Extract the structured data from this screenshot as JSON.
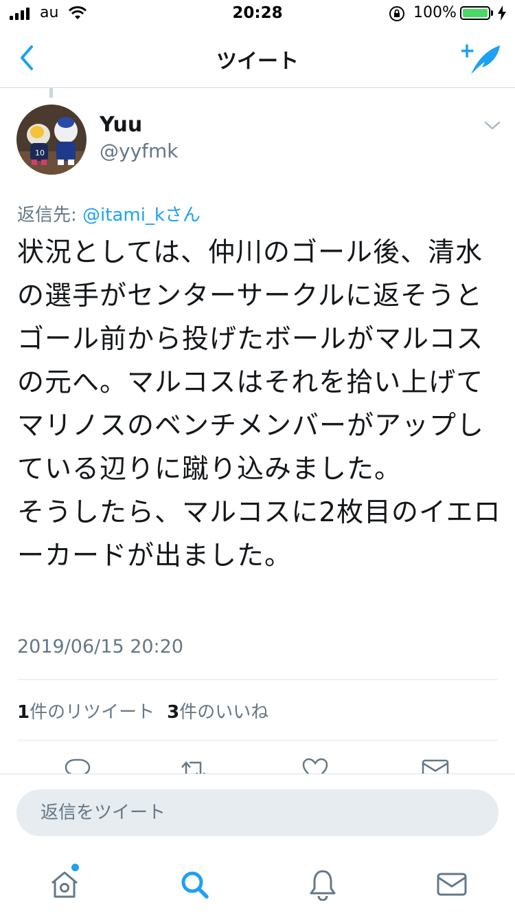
{
  "status_bar": {
    "carrier": "au",
    "time": "20:28",
    "battery_percent": "100%",
    "battery_level": 1.0
  },
  "nav": {
    "title": "ツイート",
    "back_icon": "chevron-left-icon",
    "compose_icon": "compose-tweet-icon"
  },
  "tweet": {
    "display_name": "Yuu",
    "handle": "@yyfmk",
    "reply_to_prefix": "返信先: ",
    "reply_to_user": "@itami_kさん",
    "text": "状況としては、仲川のゴール後、清水の選手がセンターサークルに返そうとゴール前から投げたボールがマルコスの元へ。マルコスはそれを拾い上げてマリノスのベンチメンバーがアップしている辺りに蹴り込みました。\nそうしたら、マルコスに2枚目のイエローカードが出ました。",
    "timestamp": "2019/06/15 20:20",
    "retweets": {
      "count": "1",
      "label": "件のリツイート"
    },
    "likes": {
      "count": "3",
      "label": "件のいいね"
    }
  },
  "actions": [
    "reply-icon",
    "retweet-icon",
    "like-icon",
    "dm-icon"
  ],
  "reply_bar": {
    "placeholder": "返信をツイート"
  },
  "tab_bar": [
    "home-icon",
    "search-icon",
    "notifications-icon",
    "messages-icon"
  ],
  "colors": {
    "accent": "#1da1f2",
    "secondary_text": "#657786",
    "battery": "#4cd964"
  }
}
